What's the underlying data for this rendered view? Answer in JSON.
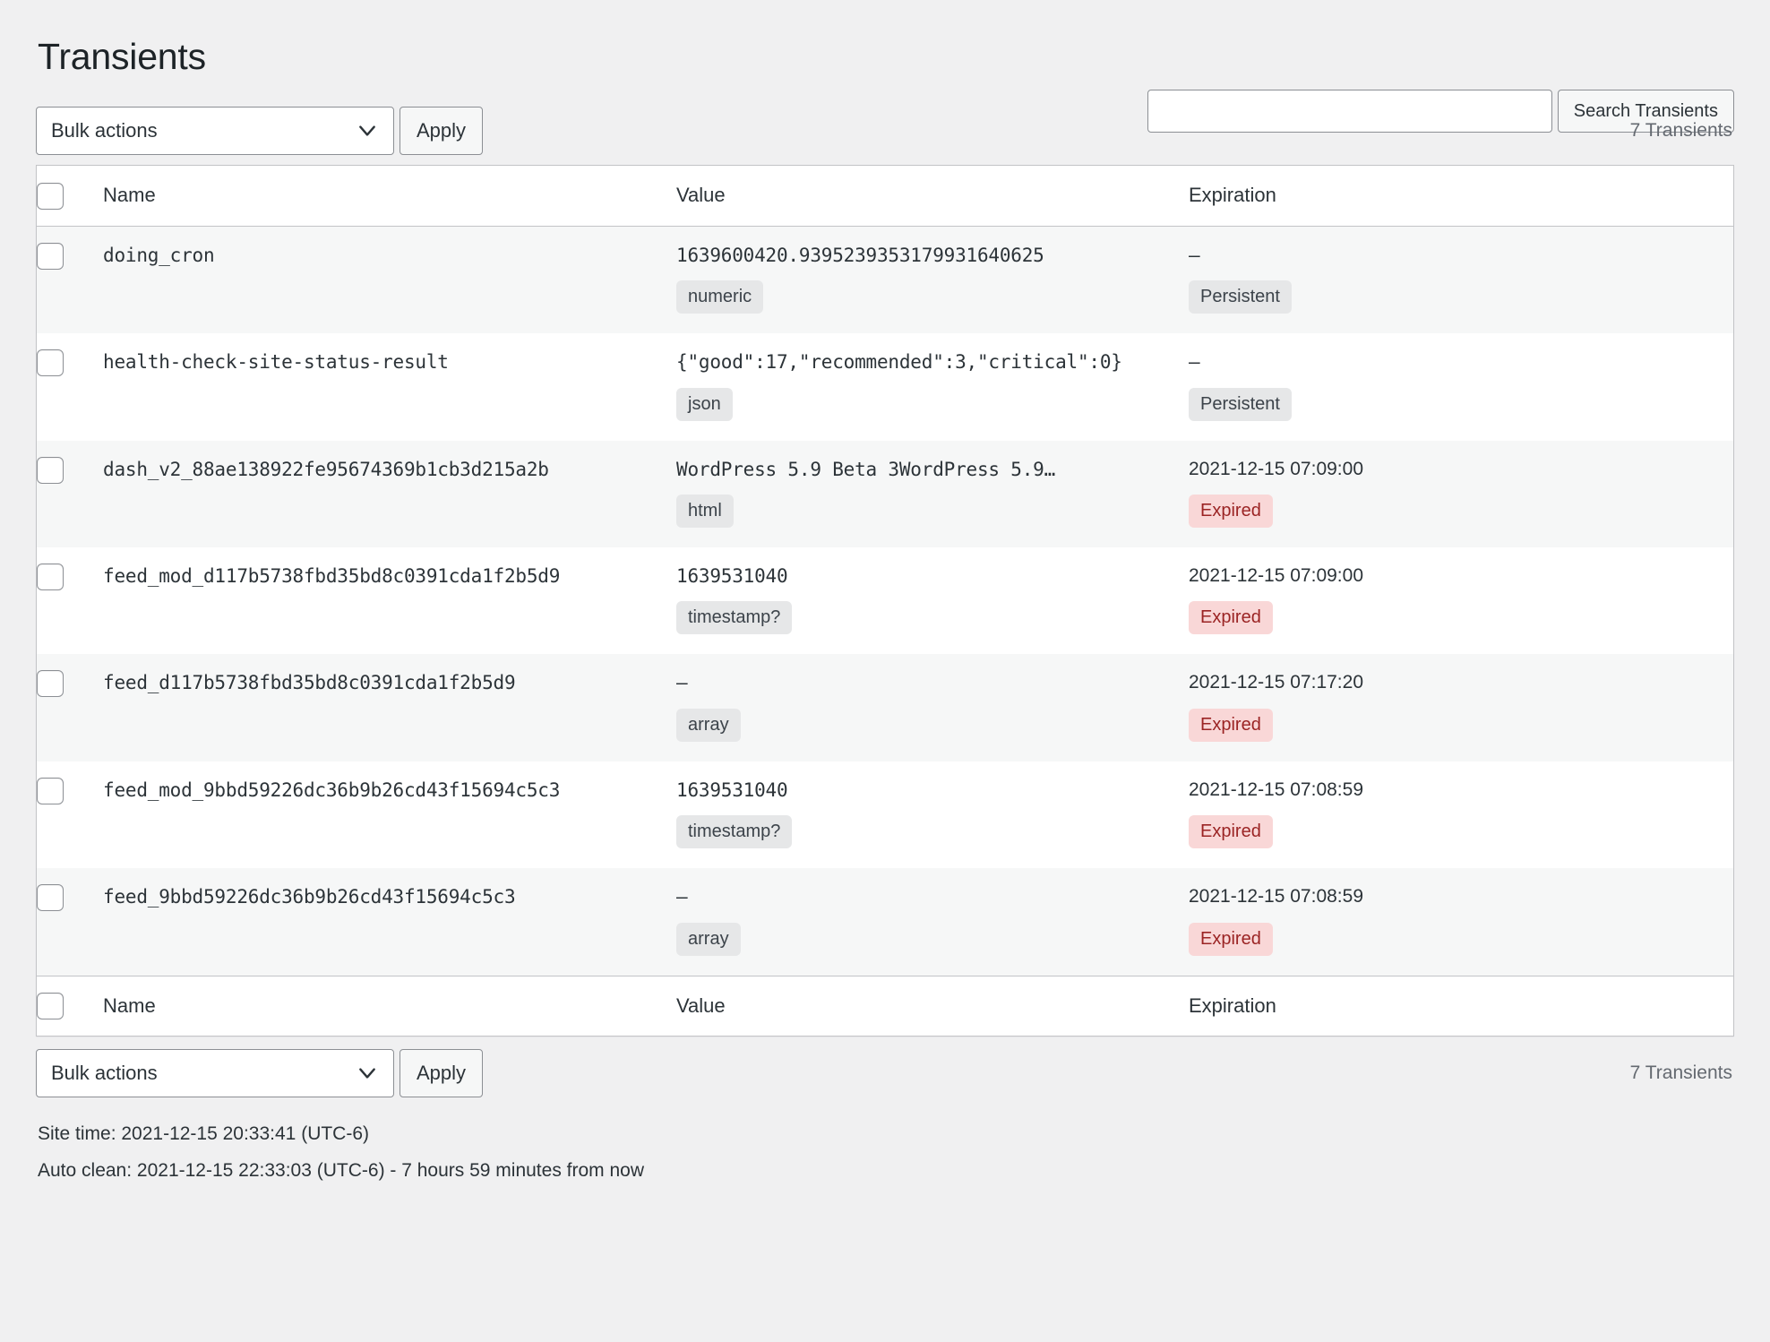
{
  "page": {
    "title": "Transients"
  },
  "search": {
    "value": "",
    "placeholder": "",
    "submit_label": "Search Transients"
  },
  "tablenav_top": {
    "bulk_actions_label": "Bulk actions",
    "apply_label": "Apply",
    "displaying_num": "7 Transients"
  },
  "tablenav_bottom": {
    "bulk_actions_label": "Bulk actions",
    "apply_label": "Apply",
    "displaying_num": "7 Transients"
  },
  "table": {
    "columns": {
      "name": "Name",
      "value": "Value",
      "expiration": "Expiration"
    },
    "rows": [
      {
        "name": "doing_cron",
        "value": "1639600420.9395239353179931640625",
        "value_badge": "numeric",
        "expiration": "—",
        "expiration_badge": "Persistent",
        "expiration_state": "persistent"
      },
      {
        "name": "health-check-site-status-result",
        "value": "{\"good\":17,\"recommended\":3,\"critical\":0}",
        "value_badge": "json",
        "expiration": "—",
        "expiration_badge": "Persistent",
        "expiration_state": "persistent"
      },
      {
        "name": "dash_v2_88ae138922fe95674369b1cb3d215a2b",
        "value": "WordPress 5.9 Beta 3WordPress 5.9…",
        "value_badge": "html",
        "expiration": "2021-12-15 07:09:00",
        "expiration_badge": "Expired",
        "expiration_state": "expired"
      },
      {
        "name": "feed_mod_d117b5738fbd35bd8c0391cda1f2b5d9",
        "value": "1639531040",
        "value_badge": "timestamp?",
        "expiration": "2021-12-15 07:09:00",
        "expiration_badge": "Expired",
        "expiration_state": "expired"
      },
      {
        "name": "feed_d117b5738fbd35bd8c0391cda1f2b5d9",
        "value": "—",
        "value_badge": "array",
        "expiration": "2021-12-15 07:17:20",
        "expiration_badge": "Expired",
        "expiration_state": "expired"
      },
      {
        "name": "feed_mod_9bbd59226dc36b9b26cd43f15694c5c3",
        "value": "1639531040",
        "value_badge": "timestamp?",
        "expiration": "2021-12-15 07:08:59",
        "expiration_badge": "Expired",
        "expiration_state": "expired"
      },
      {
        "name": "feed_9bbd59226dc36b9b26cd43f15694c5c3",
        "value": "—",
        "value_badge": "array",
        "expiration": "2021-12-15 07:08:59",
        "expiration_badge": "Expired",
        "expiration_state": "expired"
      }
    ]
  },
  "footer": {
    "site_time": "Site time: 2021-12-15 20:33:41 (UTC-6)",
    "auto_clean": "Auto clean: 2021-12-15 22:33:03 (UTC-6) - 7 hours 59 minutes from now"
  },
  "colors": {
    "page_bg": "#f0f0f1",
    "row_alt_bg": "#f6f7f7",
    "border": "#c3c4c7",
    "badge_neutral_bg": "#e6e7e8",
    "badge_expired_bg": "#f9d7d7",
    "badge_expired_text": "#9b2424",
    "text": "#2c3338"
  }
}
